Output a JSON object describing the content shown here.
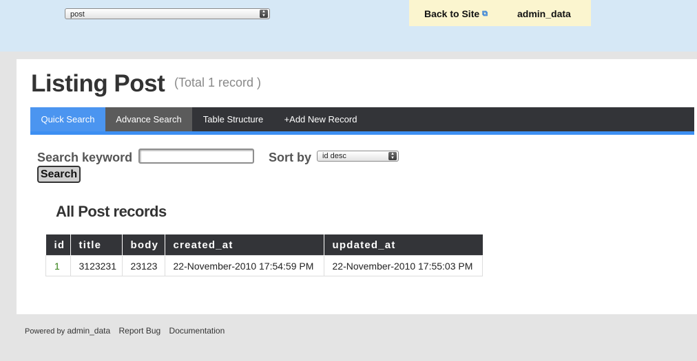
{
  "topbar": {
    "model_select": "post",
    "back_to_site": "Back to Site",
    "admin_data": "admin_data"
  },
  "page": {
    "title": "Listing Post",
    "total": "(Total 1 record )"
  },
  "tabs": [
    {
      "label": "Quick Search"
    },
    {
      "label": "Advance Search"
    },
    {
      "label": "Table Structure"
    },
    {
      "label": "+Add New Record"
    }
  ],
  "search": {
    "keyword_label": "Search keyword",
    "keyword_value": "",
    "sort_label": "Sort by",
    "sort_value": "id desc",
    "button_label": "Search"
  },
  "records": {
    "title": "All Post records",
    "columns": [
      "id",
      "title",
      "body",
      "created_at",
      "updated_at"
    ],
    "rows": [
      [
        "1",
        "3123231",
        "23123",
        "22-November-2010 17:54:59 PM",
        "22-November-2010 17:55:03 PM"
      ]
    ]
  },
  "footer": {
    "powered_prefix": "Powered by",
    "powered_link": "admin_data",
    "report_bug": "Report Bug",
    "documentation": "Documentation"
  },
  "colors": {
    "topbar_bg": "#d6e8f6",
    "tab_active": "#4b95f0",
    "tab_bar": "#333438",
    "id_link": "#2e7d10"
  }
}
